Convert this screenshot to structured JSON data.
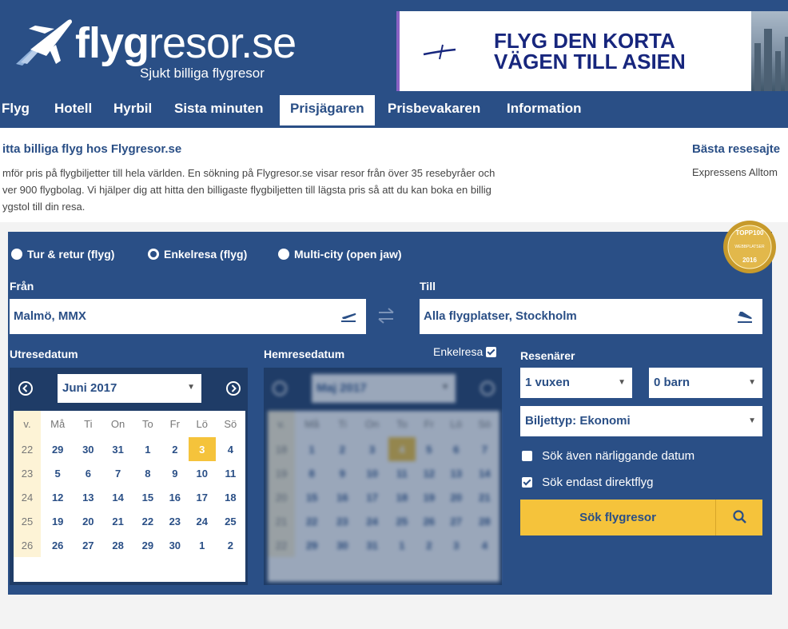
{
  "logo": {
    "brand_bold": "fly",
    "brand_mid": "g",
    "brand_rest": "resor.se",
    "tagline": "Sjukt billiga flygresor"
  },
  "ad": {
    "line1": "FLYG DEN KORTA",
    "line2": "VÄGEN TILL ASIEN"
  },
  "nav": [
    "Flyg",
    "Hotell",
    "Hyrbil",
    "Sista minuten",
    "Prisjägaren",
    "Prisbevakaren",
    "Information"
  ],
  "nav_active": "Prisjägaren",
  "intro": {
    "title": "itta billiga flyg hos Flygresor.se",
    "line1": "mför pris på flygbiljetter till hela världen. En sökning på Flygresor.se visar resor från över 35 resebyråer och",
    "line2": "ver 900 flygbolag. Vi hjälper dig att hitta den billigaste flygbiljetten till lägsta pris så att du kan boka en billig",
    "line3": "ygstol till din resa."
  },
  "side": {
    "title": "Bästa resesajte",
    "text": "Expressens Alltom"
  },
  "trip_types": [
    "Tur & retur (flyg)",
    "Enkelresa (flyg)",
    "Multi-city (open jaw)"
  ],
  "trip_type_selected": "Enkelresa (flyg)",
  "badge": {
    "top": "TOPP100",
    "mid": "WEBBPLATSER",
    "year": "2016"
  },
  "from": {
    "label": "Från",
    "value": "Malmö, MMX"
  },
  "to": {
    "label": "Till",
    "value": "Alla flygplatser, Stockholm"
  },
  "depart": {
    "label": "Utresedatum",
    "month": "Juni 2017",
    "weekdays": [
      "v.",
      "Må",
      "Ti",
      "On",
      "To",
      "Fr",
      "Lö",
      "Sö"
    ],
    "weeks": [
      [
        "22",
        "29",
        "30",
        "31",
        "1",
        "2",
        "3",
        "4"
      ],
      [
        "23",
        "5",
        "6",
        "7",
        "8",
        "9",
        "10",
        "11"
      ],
      [
        "24",
        "12",
        "13",
        "14",
        "15",
        "16",
        "17",
        "18"
      ],
      [
        "25",
        "19",
        "20",
        "21",
        "22",
        "23",
        "24",
        "25"
      ],
      [
        "26",
        "26",
        "27",
        "28",
        "29",
        "30",
        "1",
        "2"
      ]
    ],
    "selected_day": "3"
  },
  "return": {
    "label": "Hemresedatum",
    "month": "Maj 2017",
    "oneway_label": "Enkelresa",
    "oneway_checked": true,
    "weekdays": [
      "v.",
      "Må",
      "Ti",
      "On",
      "To",
      "Fr",
      "Lö",
      "Sö"
    ],
    "weeks": [
      [
        "18",
        "1",
        "2",
        "3",
        "4",
        "5",
        "6",
        "7"
      ],
      [
        "19",
        "8",
        "9",
        "10",
        "11",
        "12",
        "13",
        "14"
      ],
      [
        "20",
        "15",
        "16",
        "17",
        "18",
        "19",
        "20",
        "21"
      ],
      [
        "21",
        "22",
        "23",
        "24",
        "25",
        "26",
        "27",
        "28"
      ],
      [
        "22",
        "29",
        "30",
        "31",
        "1",
        "2",
        "3",
        "4"
      ]
    ]
  },
  "travelers": {
    "label": "Resenärer",
    "adults": "1 vuxen",
    "children": "0 barn"
  },
  "ticket_type": "Biljettyp: Ekonomi",
  "options": {
    "nearby": "Sök även närliggande datum",
    "nearby_checked": false,
    "direct": "Sök endast direktflyg",
    "direct_checked": true
  },
  "search_label": "Sök flygresor",
  "colors": {
    "brand": "#2a4f86",
    "accent": "#f5c33b",
    "ad_text": "#17267d"
  }
}
